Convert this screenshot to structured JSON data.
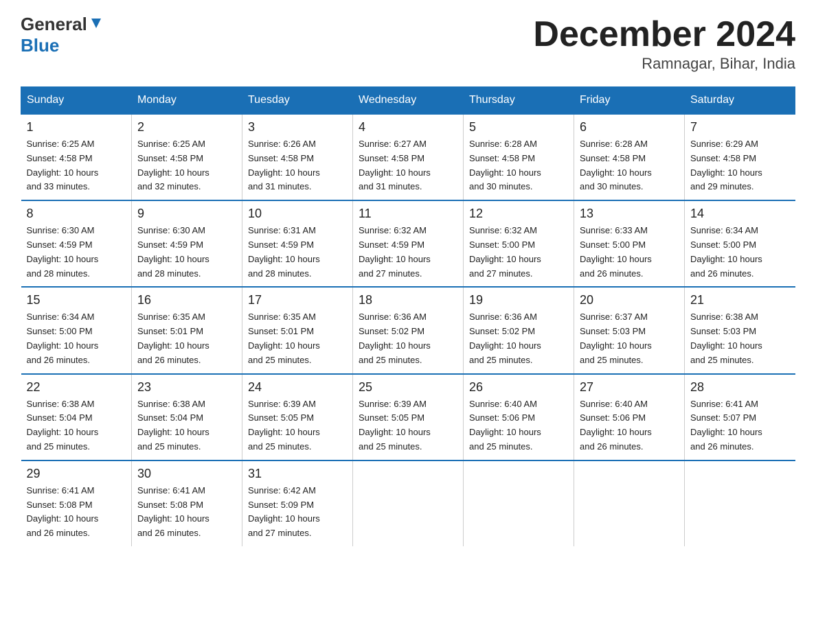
{
  "header": {
    "logo_general": "General",
    "logo_blue": "Blue",
    "month_title": "December 2024",
    "location": "Ramnagar, Bihar, India"
  },
  "days_of_week": [
    "Sunday",
    "Monday",
    "Tuesday",
    "Wednesday",
    "Thursday",
    "Friday",
    "Saturday"
  ],
  "weeks": [
    [
      {
        "day": "1",
        "sunrise": "6:25 AM",
        "sunset": "4:58 PM",
        "daylight": "10 hours and 33 minutes."
      },
      {
        "day": "2",
        "sunrise": "6:25 AM",
        "sunset": "4:58 PM",
        "daylight": "10 hours and 32 minutes."
      },
      {
        "day": "3",
        "sunrise": "6:26 AM",
        "sunset": "4:58 PM",
        "daylight": "10 hours and 31 minutes."
      },
      {
        "day": "4",
        "sunrise": "6:27 AM",
        "sunset": "4:58 PM",
        "daylight": "10 hours and 31 minutes."
      },
      {
        "day": "5",
        "sunrise": "6:28 AM",
        "sunset": "4:58 PM",
        "daylight": "10 hours and 30 minutes."
      },
      {
        "day": "6",
        "sunrise": "6:28 AM",
        "sunset": "4:58 PM",
        "daylight": "10 hours and 30 minutes."
      },
      {
        "day": "7",
        "sunrise": "6:29 AM",
        "sunset": "4:58 PM",
        "daylight": "10 hours and 29 minutes."
      }
    ],
    [
      {
        "day": "8",
        "sunrise": "6:30 AM",
        "sunset": "4:59 PM",
        "daylight": "10 hours and 28 minutes."
      },
      {
        "day": "9",
        "sunrise": "6:30 AM",
        "sunset": "4:59 PM",
        "daylight": "10 hours and 28 minutes."
      },
      {
        "day": "10",
        "sunrise": "6:31 AM",
        "sunset": "4:59 PM",
        "daylight": "10 hours and 28 minutes."
      },
      {
        "day": "11",
        "sunrise": "6:32 AM",
        "sunset": "4:59 PM",
        "daylight": "10 hours and 27 minutes."
      },
      {
        "day": "12",
        "sunrise": "6:32 AM",
        "sunset": "5:00 PM",
        "daylight": "10 hours and 27 minutes."
      },
      {
        "day": "13",
        "sunrise": "6:33 AM",
        "sunset": "5:00 PM",
        "daylight": "10 hours and 26 minutes."
      },
      {
        "day": "14",
        "sunrise": "6:34 AM",
        "sunset": "5:00 PM",
        "daylight": "10 hours and 26 minutes."
      }
    ],
    [
      {
        "day": "15",
        "sunrise": "6:34 AM",
        "sunset": "5:00 PM",
        "daylight": "10 hours and 26 minutes."
      },
      {
        "day": "16",
        "sunrise": "6:35 AM",
        "sunset": "5:01 PM",
        "daylight": "10 hours and 26 minutes."
      },
      {
        "day": "17",
        "sunrise": "6:35 AM",
        "sunset": "5:01 PM",
        "daylight": "10 hours and 25 minutes."
      },
      {
        "day": "18",
        "sunrise": "6:36 AM",
        "sunset": "5:02 PM",
        "daylight": "10 hours and 25 minutes."
      },
      {
        "day": "19",
        "sunrise": "6:36 AM",
        "sunset": "5:02 PM",
        "daylight": "10 hours and 25 minutes."
      },
      {
        "day": "20",
        "sunrise": "6:37 AM",
        "sunset": "5:03 PM",
        "daylight": "10 hours and 25 minutes."
      },
      {
        "day": "21",
        "sunrise": "6:38 AM",
        "sunset": "5:03 PM",
        "daylight": "10 hours and 25 minutes."
      }
    ],
    [
      {
        "day": "22",
        "sunrise": "6:38 AM",
        "sunset": "5:04 PM",
        "daylight": "10 hours and 25 minutes."
      },
      {
        "day": "23",
        "sunrise": "6:38 AM",
        "sunset": "5:04 PM",
        "daylight": "10 hours and 25 minutes."
      },
      {
        "day": "24",
        "sunrise": "6:39 AM",
        "sunset": "5:05 PM",
        "daylight": "10 hours and 25 minutes."
      },
      {
        "day": "25",
        "sunrise": "6:39 AM",
        "sunset": "5:05 PM",
        "daylight": "10 hours and 25 minutes."
      },
      {
        "day": "26",
        "sunrise": "6:40 AM",
        "sunset": "5:06 PM",
        "daylight": "10 hours and 25 minutes."
      },
      {
        "day": "27",
        "sunrise": "6:40 AM",
        "sunset": "5:06 PM",
        "daylight": "10 hours and 26 minutes."
      },
      {
        "day": "28",
        "sunrise": "6:41 AM",
        "sunset": "5:07 PM",
        "daylight": "10 hours and 26 minutes."
      }
    ],
    [
      {
        "day": "29",
        "sunrise": "6:41 AM",
        "sunset": "5:08 PM",
        "daylight": "10 hours and 26 minutes."
      },
      {
        "day": "30",
        "sunrise": "6:41 AM",
        "sunset": "5:08 PM",
        "daylight": "10 hours and 26 minutes."
      },
      {
        "day": "31",
        "sunrise": "6:42 AM",
        "sunset": "5:09 PM",
        "daylight": "10 hours and 27 minutes."
      },
      {
        "day": "",
        "sunrise": "",
        "sunset": "",
        "daylight": ""
      },
      {
        "day": "",
        "sunrise": "",
        "sunset": "",
        "daylight": ""
      },
      {
        "day": "",
        "sunrise": "",
        "sunset": "",
        "daylight": ""
      },
      {
        "day": "",
        "sunrise": "",
        "sunset": "",
        "daylight": ""
      }
    ]
  ],
  "labels": {
    "sunrise_prefix": "Sunrise: ",
    "sunset_prefix": "Sunset: ",
    "daylight_prefix": "Daylight: "
  }
}
